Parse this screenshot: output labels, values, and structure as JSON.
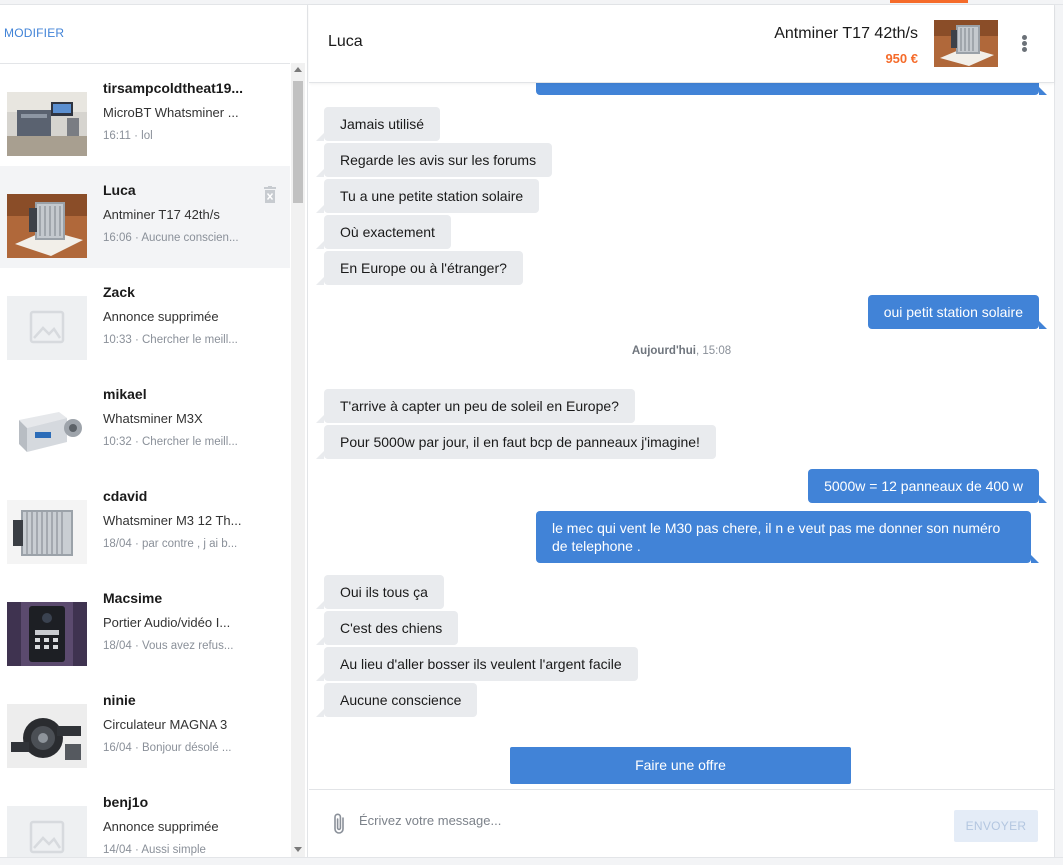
{
  "sidebar": {
    "modifier_label": "MODIFIER",
    "conversations": [
      {
        "name": "tirsampcoldtheat19...",
        "item": "MicroBT Whatsminer ...",
        "meta": "16:11 · lol",
        "thumb_icon": "mining-rig-photo",
        "active": false
      },
      {
        "name": "Luca",
        "item": "Antminer T17 42th/s",
        "meta": "16:06 · Aucune conscien...",
        "thumb_icon": "antminer-photo",
        "active": true
      },
      {
        "name": "Zack",
        "item": "Annonce supprimée",
        "meta": "10:33 · Chercher le meill...",
        "thumb_icon": "image-placeholder-icon",
        "active": false
      },
      {
        "name": "mikael",
        "item": "Whatsminer M3X",
        "meta": "10:32 · Chercher le meill...",
        "thumb_icon": "whatsminer-photo",
        "active": false
      },
      {
        "name": "cdavid",
        "item": "Whatsminer M3 12 Th...",
        "meta": "18/04 · par contre , j ai b...",
        "thumb_icon": "miner-heatsink-photo",
        "active": false
      },
      {
        "name": "Macsime",
        "item": "Portier Audio/vidéo I...",
        "meta": "18/04 · Vous avez refus...",
        "thumb_icon": "intercom-photo",
        "active": false
      },
      {
        "name": "ninie",
        "item": "Circulateur MAGNA 3",
        "meta": "16/04 · Bonjour désolé ...",
        "thumb_icon": "pump-photo",
        "active": false
      },
      {
        "name": "benj1o",
        "item": "Annonce supprimée",
        "meta": "14/04 · Aussi simple",
        "thumb_icon": "image-placeholder-icon",
        "active": false
      }
    ]
  },
  "header": {
    "contact_name": "Luca",
    "ad_title": "Antminer T17 42th/s",
    "price": "950 €",
    "thumb_icon": "antminer-photo",
    "menu_icon": "kebab-menu-icon"
  },
  "messages": [
    {
      "dir": "in",
      "text": "Jamais utilisé"
    },
    {
      "dir": "in",
      "text": "Regarde les avis sur les forums"
    },
    {
      "dir": "in",
      "text": "Tu a une petite station solaire"
    },
    {
      "dir": "in",
      "text": "Où exactement"
    },
    {
      "dir": "in",
      "text": "En Europe ou à l'étranger?"
    },
    {
      "dir": "out",
      "text": "oui petit station solaire"
    },
    {
      "dir": "in",
      "text": "T'arrive à capter un peu de soleil en Europe?"
    },
    {
      "dir": "in",
      "text": "Pour 5000w par jour, il en faut bcp de panneaux j'imagine!"
    },
    {
      "dir": "out",
      "text": "5000w = 12 panneaux de 400 w"
    },
    {
      "dir": "out",
      "text": "le mec qui vent le M30 pas chere, il n e veut pas me donner son numéro de telephone ."
    },
    {
      "dir": "in",
      "text": "Oui ils tous ça"
    },
    {
      "dir": "in",
      "text": "C'est des chiens"
    },
    {
      "dir": "in",
      "text": "Au lieu d'aller bosser ils veulent l'argent facile"
    },
    {
      "dir": "in",
      "text": "Aucune conscience"
    }
  ],
  "date_separator": {
    "day": "Aujourd'hui",
    "time": ", 15:08"
  },
  "offer_button": "Faire une offre",
  "composer": {
    "placeholder": "Écrivez votre message...",
    "send_label": "ENVOYER",
    "attach_icon": "paperclip-icon"
  },
  "colors": {
    "accent_blue": "#4183d7",
    "accent_orange": "#f56b2a",
    "incoming_bubble": "#e9ebee",
    "active_row": "#f3f4f6"
  }
}
